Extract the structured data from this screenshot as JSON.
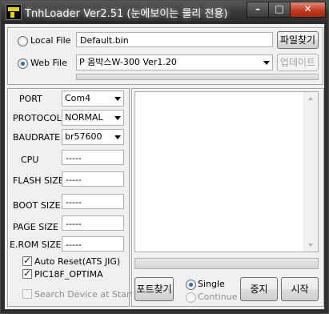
{
  "window": {
    "title": "TnhLoader Ver2.51 (눈에보이는 물리 전용)",
    "controls": {
      "minimize": "–",
      "maximize": "□",
      "close": "✕"
    }
  },
  "source": {
    "local_file": {
      "label": "Local File",
      "selected": false,
      "value": "Default.bin",
      "button": "파일찾기"
    },
    "web_file": {
      "label": "Web File",
      "selected": true,
      "value": "P 옴박스W-300 Ver1.20",
      "button": "업데이트",
      "button_disabled": true
    }
  },
  "settings": {
    "port": {
      "label": "PORT",
      "value": "Com4"
    },
    "protocol": {
      "label": "PROTOCOL",
      "value": "NORMAL"
    },
    "baudrate": {
      "label": "BAUDRATE",
      "value": "br57600"
    },
    "cpu": {
      "label": "CPU",
      "value": "-----"
    },
    "flash_size": {
      "label": "FLASH SIZE",
      "value": "-----"
    },
    "boot_size": {
      "label": "BOOT SIZE",
      "value": "-----"
    },
    "page_size": {
      "label": "PAGE SIZE",
      "value": "-----"
    },
    "erom_size": {
      "label": "E.ROM SIZE",
      "value": "-----"
    }
  },
  "options": {
    "auto_reset": {
      "label": "Auto Reset(ATS JIG)",
      "checked": true
    },
    "pic18f_optima": {
      "label": "PIC18F_OPTIMA",
      "checked": true
    },
    "search_device": {
      "label": "Search Device at Start",
      "checked": false,
      "disabled": true
    }
  },
  "actions": {
    "port_find": "포트찾기",
    "single": {
      "label": "Single",
      "selected": true
    },
    "continue": {
      "label": "Continue",
      "selected": false,
      "disabled": true
    },
    "stop": "중지",
    "start": "시작"
  },
  "progress": {
    "top": 0,
    "right": 0
  },
  "colors": {
    "accent": "#2a6fb5",
    "titlebar": "#3b3b3b",
    "close": "#c23a22"
  },
  "icons": {
    "app": "tnh-loader-icon"
  }
}
